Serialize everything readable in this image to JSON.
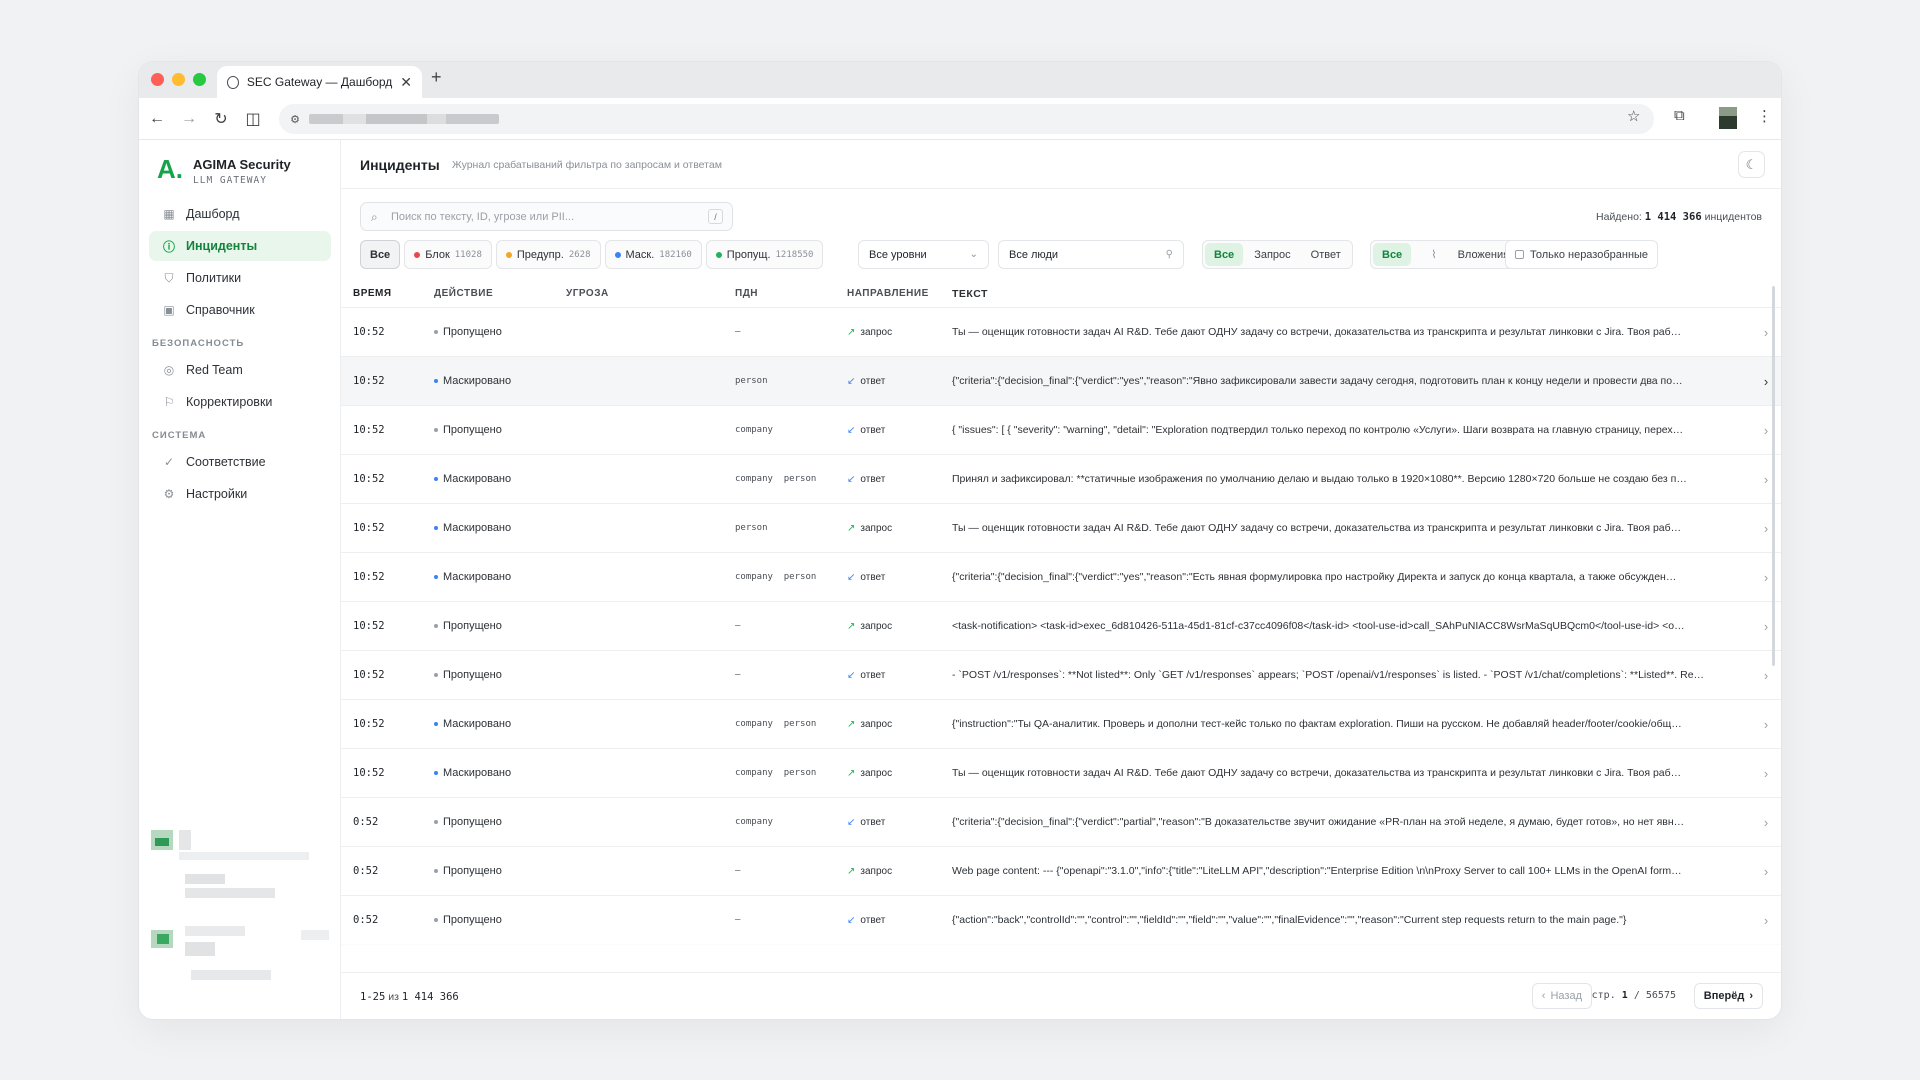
{
  "browser": {
    "tab_title": "SEC Gateway — Дашборд",
    "new_tab": "+",
    "close": "✕"
  },
  "brand": {
    "name": "AGIMA Security",
    "sub": "LLM GATEWAY"
  },
  "nav": {
    "items": [
      {
        "label": "Дашборд",
        "icon": "grid-icon"
      },
      {
        "label": "Инциденты",
        "icon": "alert-circle-icon"
      },
      {
        "label": "Политики",
        "icon": "shield-icon"
      },
      {
        "label": "Справочник",
        "icon": "book-icon"
      }
    ],
    "section_security": "БЕЗОПАСНОСТЬ",
    "security_items": [
      {
        "label": "Red Team",
        "icon": "target-icon"
      },
      {
        "label": "Корректировки",
        "icon": "flag-icon"
      }
    ],
    "section_system": "СИСТЕМА",
    "system_items": [
      {
        "label": "Соответствие",
        "icon": "check-circle-icon"
      },
      {
        "label": "Настройки",
        "icon": "gear-icon"
      }
    ]
  },
  "page": {
    "title": "Инциденты",
    "subtitle": "Журнал срабатываний фильтра по запросам и ответам"
  },
  "search": {
    "placeholder": "Поиск по тексту, ID, угрозе или PII...",
    "shortcut": "/"
  },
  "found": {
    "label": "Найдено:",
    "count": "1 414 366",
    "suffix": "инцидентов"
  },
  "filters": {
    "all": "Все",
    "block": {
      "label": "Блок",
      "count": "11028",
      "color": "#e5484d"
    },
    "warn": {
      "label": "Предупр.",
      "count": "2628",
      "color": "#f5a524"
    },
    "mask": {
      "label": "Маск.",
      "count": "182160",
      "color": "#3b82f6"
    },
    "pass": {
      "label": "Пропущ.",
      "count": "1218550",
      "color": "#22b45a"
    },
    "levels": "Все уровни",
    "people": "Все люди",
    "direction": [
      "Все",
      "Запрос",
      "Ответ"
    ],
    "attachments": [
      "Все",
      "Вложения"
    ],
    "unreviewed": "Только неразобранные"
  },
  "table": {
    "headers": [
      "ВРЕМЯ",
      "ДЕЙСТВИЕ",
      "УГРОЗА",
      "ПДН",
      "НАПРАВЛЕНИЕ",
      "ТЕКСТ"
    ],
    "rows": [
      {
        "time": "10:52",
        "action": "Пропущено",
        "pii": "–",
        "dir": "запрос",
        "text": "Ты — оценщик готовности задач AI R&D. Тебе дают ОДНУ задачу со встречи, доказательства из транскрипта и результат линковки с Jira. Твоя раб…"
      },
      {
        "time": "10:52",
        "action": "Маскировано",
        "pii": "person",
        "dir": "ответ",
        "text": "{\"criteria\":{\"decision_final\":{\"verdict\":\"yes\",\"reason\":\"Явно зафиксировали завести задачу сегодня, подготовить план к концу недели и провести два по…"
      },
      {
        "time": "10:52",
        "action": "Пропущено",
        "pii": "company",
        "dir": "ответ",
        "text": "{ \"issues\": [ { \"severity\": \"warning\", \"detail\": \"Exploration подтвердил только переход по контролю «Услуги». Шаги возврата на главную страницу, перех…"
      },
      {
        "time": "10:52",
        "action": "Маскировано",
        "pii": "company  person",
        "dir": "ответ",
        "text": "Принял и зафиксировал: **статичные изображения по умолчанию делаю и выдаю только в 1920×1080**. Версию 1280×720 больше не создаю без п…"
      },
      {
        "time": "10:52",
        "action": "Маскировано",
        "pii": "person",
        "dir": "запрос",
        "text": "Ты — оценщик готовности задач AI R&D. Тебе дают ОДНУ задачу со встречи, доказательства из транскрипта и результат линковки с Jira. Твоя раб…"
      },
      {
        "time": "10:52",
        "action": "Маскировано",
        "pii": "company  person",
        "dir": "ответ",
        "text": "{\"criteria\":{\"decision_final\":{\"verdict\":\"yes\",\"reason\":\"Есть явная формулировка про настройку Директа и запуск до конца квартала, а также обсужден…"
      },
      {
        "time": "10:52",
        "action": "Пропущено",
        "pii": "–",
        "dir": "запрос",
        "text": "<task-notification> <task-id>exec_6d810426-511a-45d1-81cf-c37cc4096f08</task-id> <tool-use-id>call_SAhPuNIACC8WsrMaSqUBQcm0</tool-use-id> <o…"
      },
      {
        "time": "10:52",
        "action": "Пропущено",
        "pii": "–",
        "dir": "ответ",
        "text": "- `POST /v1/responses`: **Not listed**: Only `GET /v1/responses` appears; `POST /openai/v1/responses` is listed. - `POST /v1/chat/completions`: **Listed**. Re…"
      },
      {
        "time": "10:52",
        "action": "Маскировано",
        "pii": "company  person",
        "dir": "запрос",
        "text": "{\"instruction\":\"Ты QA-аналитик. Проверь и дополни тест-кейс только по фактам exploration. Пиши на русском. Не добавляй header/footer/cookie/общ…"
      },
      {
        "time": "10:52",
        "action": "Маскировано",
        "pii": "company  person",
        "dir": "запрос",
        "text": "Ты — оценщик готовности задач AI R&D. Тебе дают ОДНУ задачу со встречи, доказательства из транскрипта и результат линковки с Jira. Твоя раб…"
      },
      {
        "time": "0:52",
        "action": "Пропущено",
        "pii": "company",
        "dir": "ответ",
        "text": "{\"criteria\":{\"decision_final\":{\"verdict\":\"partial\",\"reason\":\"В доказательстве звучит ожидание «PR-план на этой неделе, я думаю, будет готов», но нет явн…"
      },
      {
        "time": "0:52",
        "action": "Пропущено",
        "pii": "–",
        "dir": "запрос",
        "text": "Web page content: --- {\"openapi\":\"3.1.0\",\"info\":{\"title\":\"LiteLLM API\",\"description\":\"Enterprise Edition \\n\\nProxy Server to call 100+ LLMs in the OpenAI form…"
      },
      {
        "time": "0:52",
        "action": "Пропущено",
        "pii": "–",
        "dir": "ответ",
        "text": "{\"action\":\"back\",\"controlId\":\"\",\"control\":\"\",\"fieldId\":\"\",\"field\":\"\",\"value\":\"\",\"finalEvidence\":\"\",\"reason\":\"Current step requests return to the main page.\"}"
      }
    ]
  },
  "status_colors": {
    "pass": "#9aa0a7",
    "mask": "#3b82f6"
  },
  "pager": {
    "range_start": "1-25",
    "of": "из",
    "total": "1 414 366",
    "prev": "Назад",
    "page_label": "стр.",
    "page": "1",
    "sep": "/",
    "pages": "56575",
    "next": "Вперёд"
  }
}
